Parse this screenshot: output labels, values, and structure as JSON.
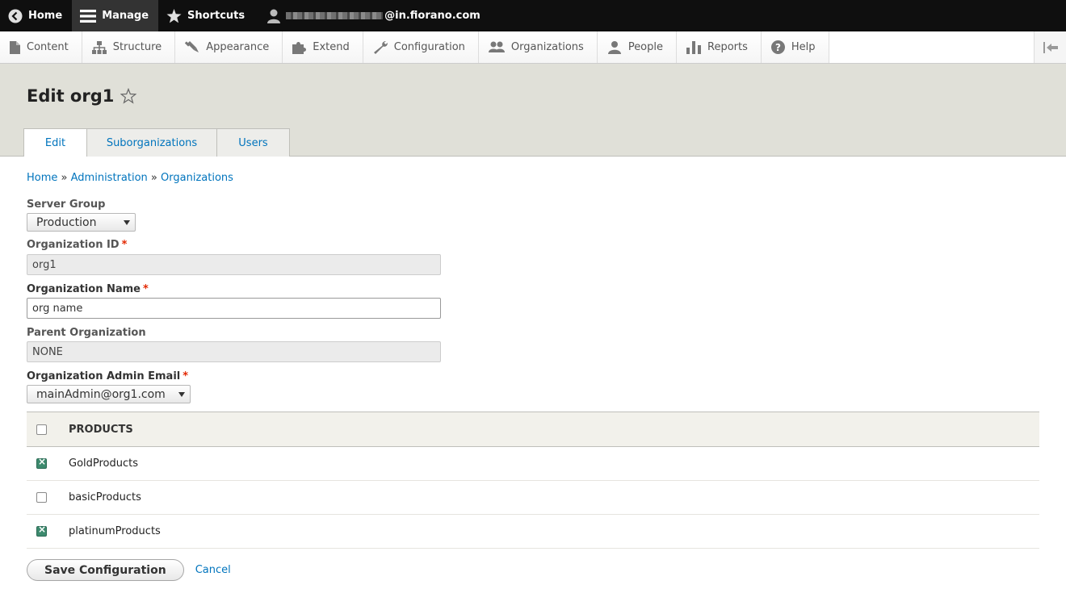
{
  "toolbar": {
    "home": "Home",
    "manage": "Manage",
    "shortcuts": "Shortcuts",
    "user_suffix": "@in.fiorano.com"
  },
  "tray": {
    "items": [
      "Content",
      "Structure",
      "Appearance",
      "Extend",
      "Configuration",
      "Organizations",
      "People",
      "Reports",
      "Help"
    ]
  },
  "page": {
    "title": "Edit org1",
    "tabs": [
      "Edit",
      "Suborganizations",
      "Users"
    ]
  },
  "breadcrumb": {
    "home": "Home",
    "sep": "»",
    "administration": "Administration",
    "organizations": "Organizations"
  },
  "form": {
    "server_group": {
      "label": "Server Group",
      "value": "Production"
    },
    "org_id": {
      "label": "Organization ID",
      "value": "org1",
      "required": "*"
    },
    "org_name": {
      "label": "Organization Name",
      "value": "org name",
      "required": "*"
    },
    "parent_org": {
      "label": "Parent Organization",
      "value": "NONE"
    },
    "admin_email": {
      "label": "Organization Admin Email",
      "value": "mainAdmin@org1.com",
      "required": "*"
    }
  },
  "products": {
    "header": "PRODUCTS",
    "rows": [
      {
        "name": "GoldProducts",
        "checked": true
      },
      {
        "name": "basicProducts",
        "checked": false
      },
      {
        "name": "platinumProducts",
        "checked": true
      }
    ]
  },
  "actions": {
    "save": "Save Configuration",
    "cancel": "Cancel"
  },
  "colors": {
    "link": "#0074bd",
    "required": "#e32700",
    "checked": "#3d8a6e",
    "header_bg": "#e0e0d8"
  }
}
